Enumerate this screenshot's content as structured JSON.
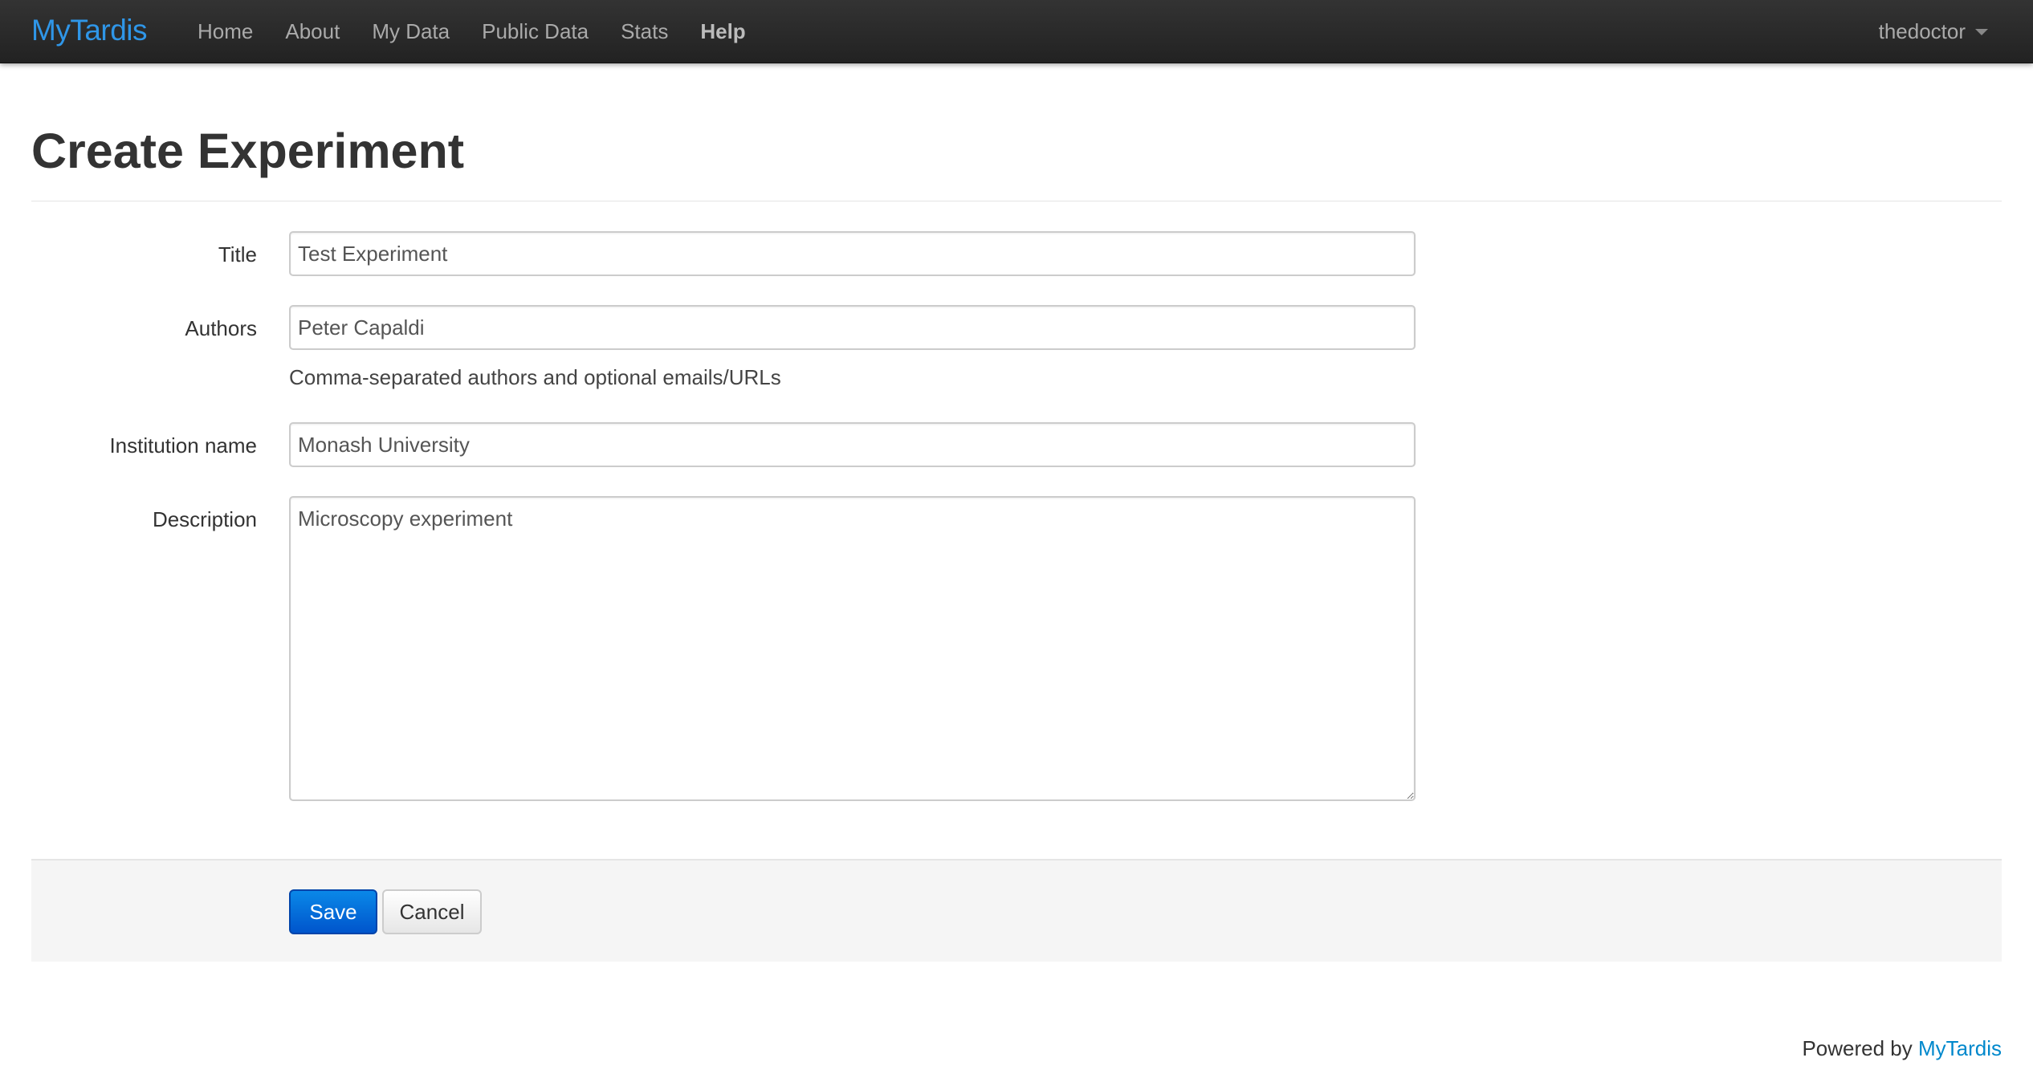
{
  "navbar": {
    "brand": "MyTardis",
    "items": [
      {
        "label": "Home"
      },
      {
        "label": "About"
      },
      {
        "label": "My Data"
      },
      {
        "label": "Public Data"
      },
      {
        "label": "Stats"
      },
      {
        "label": "Help"
      }
    ],
    "user": "thedoctor"
  },
  "page": {
    "title": "Create Experiment"
  },
  "form": {
    "title": {
      "label": "Title",
      "value": "Test Experiment"
    },
    "authors": {
      "label": "Authors",
      "value": "Peter Capaldi",
      "help": "Comma-separated authors and optional emails/URLs"
    },
    "institution": {
      "label": "Institution name",
      "value": "Monash University"
    },
    "description": {
      "label": "Description",
      "value": "Microscopy experiment"
    }
  },
  "actions": {
    "save_label": "Save",
    "cancel_label": "Cancel"
  },
  "footer": {
    "prefix": "Powered by",
    "link": "MyTardis"
  },
  "colors": {
    "brand": "#2f96e8",
    "primary_button": "#0066dd",
    "link": "#0088cc"
  }
}
